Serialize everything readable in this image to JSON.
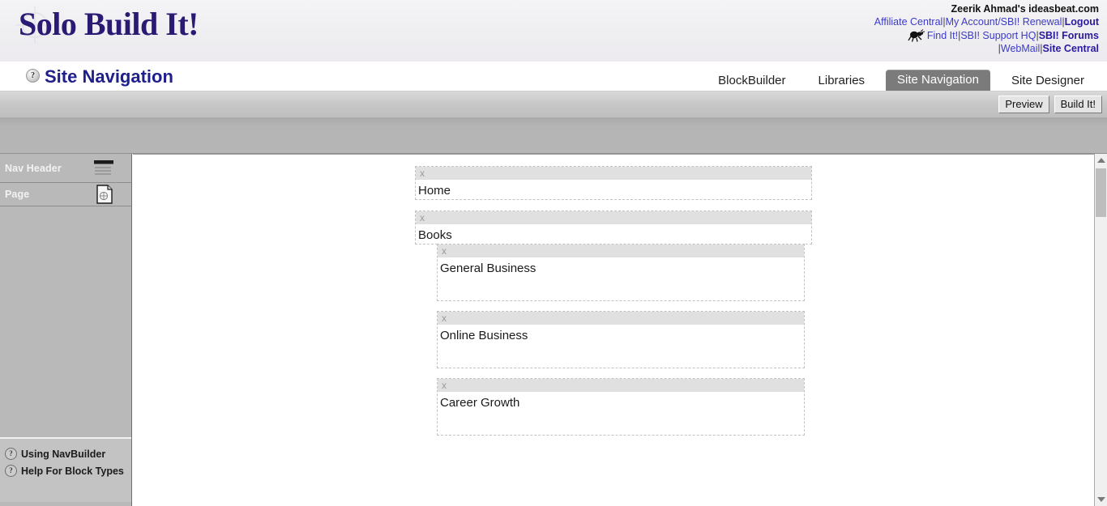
{
  "brand": {
    "logo_text": "Solo Build It!",
    "logo_icon": "compass-star-watermark"
  },
  "account": {
    "user_line": "Zeerik Ahmad's ideasbeat.com",
    "line2": [
      {
        "label": "Affiliate Central",
        "style": "link"
      },
      {
        "label": "My Account/SBI! Renewal",
        "style": "link"
      },
      {
        "label": "Logout",
        "style": "strong"
      }
    ],
    "line3": [
      {
        "label": "Find It!",
        "style": "link"
      },
      {
        "label": "SBI! Support HQ",
        "style": "link"
      },
      {
        "label": "SBI! Forums",
        "style": "strong"
      }
    ],
    "line4": [
      {
        "label": "WebMail",
        "style": "link"
      },
      {
        "label": "Site Central",
        "style": "strong"
      }
    ],
    "ant_icon": "ant-icon",
    "separator": "|"
  },
  "page": {
    "title": "Site Navigation",
    "help_icon": "question-mark-icon"
  },
  "tabs": [
    {
      "label": "BlockBuilder",
      "active": false
    },
    {
      "label": "Libraries",
      "active": false
    },
    {
      "label": "Site Navigation",
      "active": true
    },
    {
      "label": "Site Designer",
      "active": false
    }
  ],
  "toolbar": {
    "preview_label": "Preview",
    "build_label": "Build It!"
  },
  "sidebar": {
    "block_types": [
      {
        "label": "Nav Header",
        "icon": "nav-header-lines-icon"
      },
      {
        "label": "Page",
        "icon": "page-document-icon"
      }
    ],
    "help_links": [
      {
        "label": "Using NavBuilder",
        "icon": "question-mark-icon"
      },
      {
        "label": "Help For Block Types",
        "icon": "question-mark-icon"
      }
    ]
  },
  "canvas": {
    "close_glyph": "x",
    "blocks": [
      {
        "label": "Home",
        "children": []
      },
      {
        "label": "Books",
        "children": [
          {
            "label": "General Business"
          },
          {
            "label": "Online Business"
          },
          {
            "label": "Career Growth"
          }
        ]
      }
    ]
  },
  "scrollbar": {
    "up_arrow": "scroll-up-arrow-icon",
    "down_arrow": "scroll-down-arrow-icon",
    "thumb": "scroll-thumb"
  },
  "colors": {
    "brand_navy": "#2a1a73",
    "title_navy": "#20208c",
    "link_blue": "#3b3bc8",
    "active_tab_bg": "#7b7b7b",
    "sidebar_bg": "#b9b9b9",
    "block_head_bg": "#e0e0e0"
  }
}
